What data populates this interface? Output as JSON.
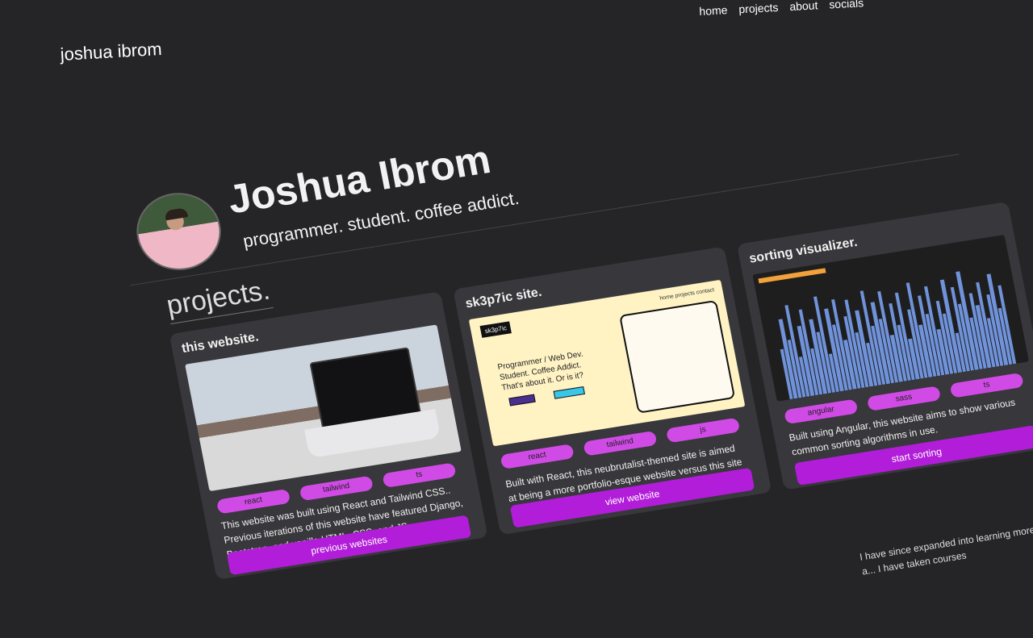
{
  "nav": {
    "items": [
      "home",
      "projects",
      "about",
      "socials"
    ]
  },
  "brand": "joshua ibrom",
  "hero": {
    "name": "Joshua Ibrom",
    "tagline": "programmer. student. coffee addict."
  },
  "section": {
    "title": "projects."
  },
  "cards": [
    {
      "title": "this website.",
      "tags": [
        "react",
        "tailwind",
        "ts"
      ],
      "description": "This website was built using React and Tailwind CSS.. Previous iterations of this website have featured Django, Bootstrap, and vanilla HTML, CSS, and JS.",
      "button": "previous websites"
    },
    {
      "title": "sk3p7ic site.",
      "tags": [
        "react",
        "tailwind",
        "js"
      ],
      "description": "Built with React, this neubrutalist-themed site is aimed at being a more portfolio-esque website versus this site which serves more as an online resume.",
      "button": "view website",
      "preview": {
        "logo": "sk3p7ic",
        "nav": "home  projects  contact",
        "text1": "Programmer / Web Dev.",
        "text2": "Student. Coffee Addict.",
        "text3": "That's about it. Or is it?"
      }
    },
    {
      "title": "sorting visualizer.",
      "tags": [
        "angular",
        "sass",
        "ts"
      ],
      "description": "Built using Angular, this website aims to show various common sorting algorithms in use.",
      "button": "start sorting"
    }
  ],
  "extra_text": "I have since expanded into learning more a... I have taken courses"
}
